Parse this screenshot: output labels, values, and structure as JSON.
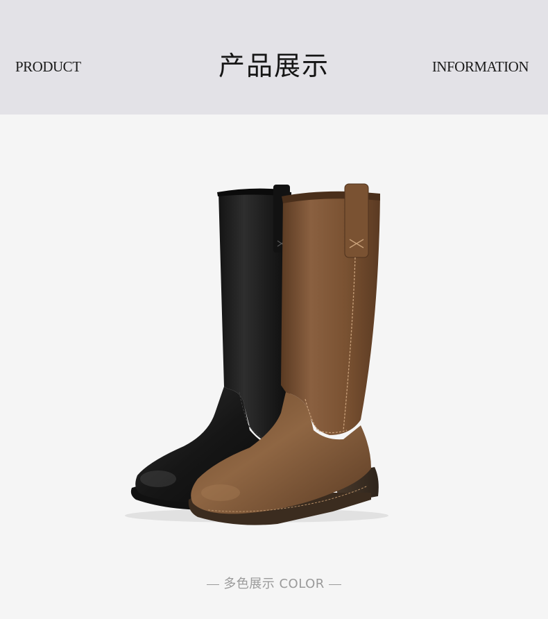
{
  "header": {
    "left_text": "PRODUCT",
    "title": "产品展示",
    "right_text": "INFORMATION"
  },
  "caption": {
    "text": "多色展示 COLOR"
  },
  "colors": {
    "header_bg": "#e3e2e7",
    "photo_bg": "#f5f5f5",
    "boot_black": "#1e1e1e",
    "boot_brown": "#7a5434"
  },
  "product": {
    "variants": [
      "black",
      "brown"
    ]
  }
}
